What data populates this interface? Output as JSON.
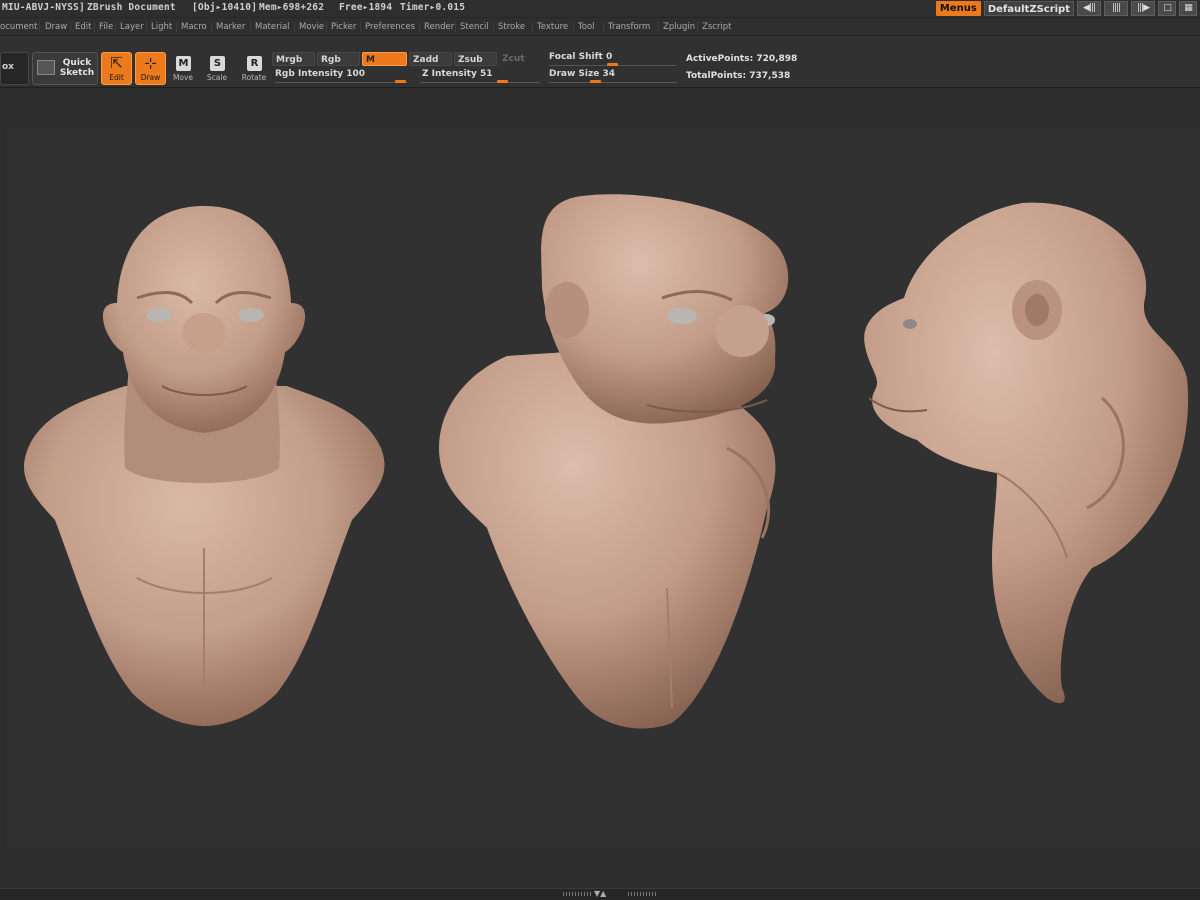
{
  "title_bar": {
    "doc_id": "MIU-ABVJ-NYSS]",
    "app_title": "ZBrush Document",
    "obj": "[Obj▸10410]",
    "mem": "Mem▸698+262",
    "free": "Free▸1894",
    "timer": "Timer▸0.015",
    "menus_label": "Menus",
    "script_label": "DefaultZScript"
  },
  "menu": [
    "ocument",
    "Draw",
    "Edit",
    "File",
    "Layer",
    "Light",
    "Macro",
    "Marker",
    "Material",
    "Movie",
    "Picker",
    "Preferences",
    "Render",
    "Stencil",
    "Stroke",
    "Texture",
    "Tool",
    "Transform",
    "Zplugin",
    "Zscript"
  ],
  "toolbar": {
    "box_label": "ox",
    "quick_sketch_line1": "Quick",
    "quick_sketch_line2": "Sketch",
    "edit_label": "Edit",
    "draw_label": "Draw",
    "move_label": "Move",
    "scale_label": "Scale",
    "rotate_label": "Rotate",
    "move_glyph": "M",
    "scale_glyph": "S",
    "rotate_glyph": "R",
    "mrgb": "Mrgb",
    "rgb": "Rgb",
    "m": "M",
    "zadd": "Zadd",
    "zsub": "Zsub",
    "zcut": "Zcut",
    "rgb_intensity_label": "Rgb Intensity",
    "rgb_intensity_value": "100",
    "z_intensity_label": "Z Intensity",
    "z_intensity_value": "51",
    "focal_shift_label": "Focal Shift",
    "focal_shift_value": "0",
    "draw_size_label": "Draw Size",
    "draw_size_value": "34",
    "active_points": "ActivePoints: 720,898",
    "total_points": "TotalPoints: 737,538"
  },
  "canvas": {
    "subject": "three views of a sculpted ape-like bust",
    "skin_color": "#c8a592"
  },
  "colors": {
    "accent": "#ec7a1c",
    "background": "#2d2d2d",
    "canvas": "#313131"
  }
}
